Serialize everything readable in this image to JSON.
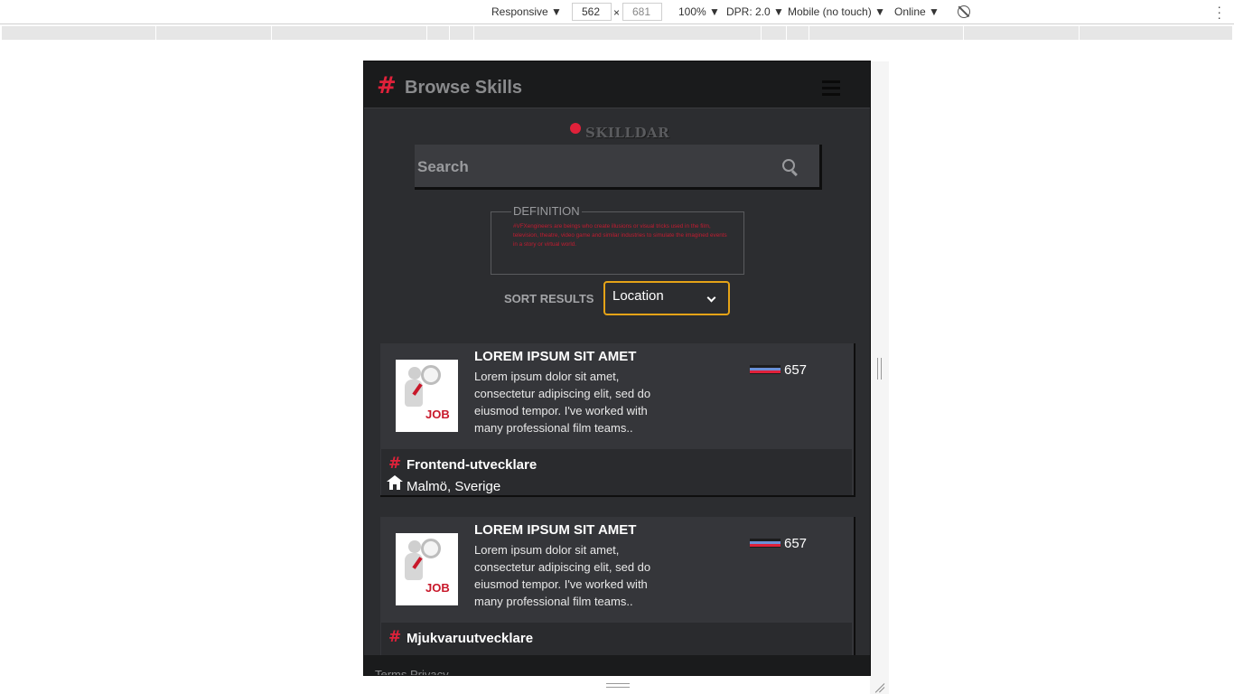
{
  "devtools": {
    "device_mode": "Responsive",
    "width": "562",
    "times": "×",
    "height": "681",
    "zoom": "100%",
    "dpr": "DPR: 2.0",
    "device_type": "Mobile (no touch)",
    "throttling": "Online",
    "caret": "▼",
    "more_menu_icon": "kebab-icon",
    "rotate_icon": "rotate-icon"
  },
  "app": {
    "hash_symbol": "#",
    "title": "Browse Skills",
    "menu_icon": "hamburger-icon",
    "logo_text": "SKILLDAR",
    "search": {
      "placeholder": "Search",
      "icon": "search-icon"
    },
    "definition": {
      "legend": "DEFINITION",
      "text": "#VFXengineers are beings who create illusions or visual tricks used in the film, television, theatre, video game and similar industries to simulate the imagined events in a story or virtual world."
    },
    "sort": {
      "label": "SORT RESULTS",
      "selected": "Location"
    },
    "results": [
      {
        "title": "LOREM IPSUM SIT AMET",
        "description": "Lorem ipsum dolor sit amet, consectetur adipiscing elit, sed do eiusmod tempor. I've worked with many professional film teams..",
        "score": "657",
        "image_text": "JOB",
        "skill": "Frontend-utvecklare",
        "location": "Malmö, Sverige"
      },
      {
        "title": "LOREM IPSUM SIT AMET",
        "description": "Lorem ipsum dolor sit amet, consectetur adipiscing elit, sed do eiusmod tempor. I've worked with many professional film teams..",
        "score": "657",
        "image_text": "JOB",
        "skill": "Mjukvaruutvecklare",
        "location": ""
      }
    ],
    "footer": {
      "links": "Terms Privacy"
    }
  },
  "colors": {
    "accent_red": "#e0213a",
    "select_border": "#e5a317",
    "background": "#2c2d30",
    "appbar": "#1a1b1c"
  }
}
